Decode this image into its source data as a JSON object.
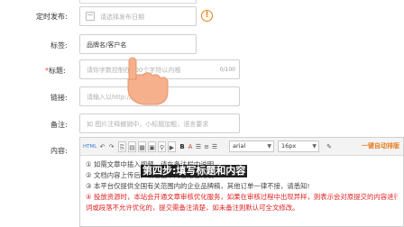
{
  "form": {
    "schedule": {
      "label": "定时发布:",
      "placeholder": "请选择发布日期"
    },
    "tags": {
      "label": "标签:",
      "value": "品牌名/客户名"
    },
    "title": {
      "label_star": "*",
      "label": "标题:",
      "placeholder": "请你字数控制在100个字符以内哦",
      "counter": "0/100"
    },
    "link": {
      "label": "链接:",
      "placeholder": "请输入以http://开头的链接"
    },
    "remark": {
      "label": "备注:",
      "placeholder": "如 图片注释撤销中，小标题加粗，语言要求"
    },
    "content": {
      "label": "内容:"
    }
  },
  "toolbar": {
    "html_label": "HTML",
    "bold": "B",
    "italic": "I",
    "underline": "U",
    "font_name": "arial",
    "font_size": "16px",
    "auto_format": "一键自动排版"
  },
  "notes": [
    "① 如需文章中插入视频，请在备注栏中说明",
    "② 文档内容上传后，请检查下内容是否无误",
    "③ 本平台仅提供全国有关范围内的企业品牌稿，其他订单一律不接，请悉知!",
    "④ 投放资源时，本站会开通文章审核优化服务，如果在审核过程中出现异样，则表示会对原提交的内容进行优化",
    "词或段落不允许优化的，提交需备注清楚，如未备注则默认可全文修改。"
  ],
  "step_banner": "第四步:填写标题和内容",
  "colors": {
    "accent_red": "#e64340",
    "warn_orange": "#ef7f1a",
    "auto_orange": "#e67e22"
  }
}
